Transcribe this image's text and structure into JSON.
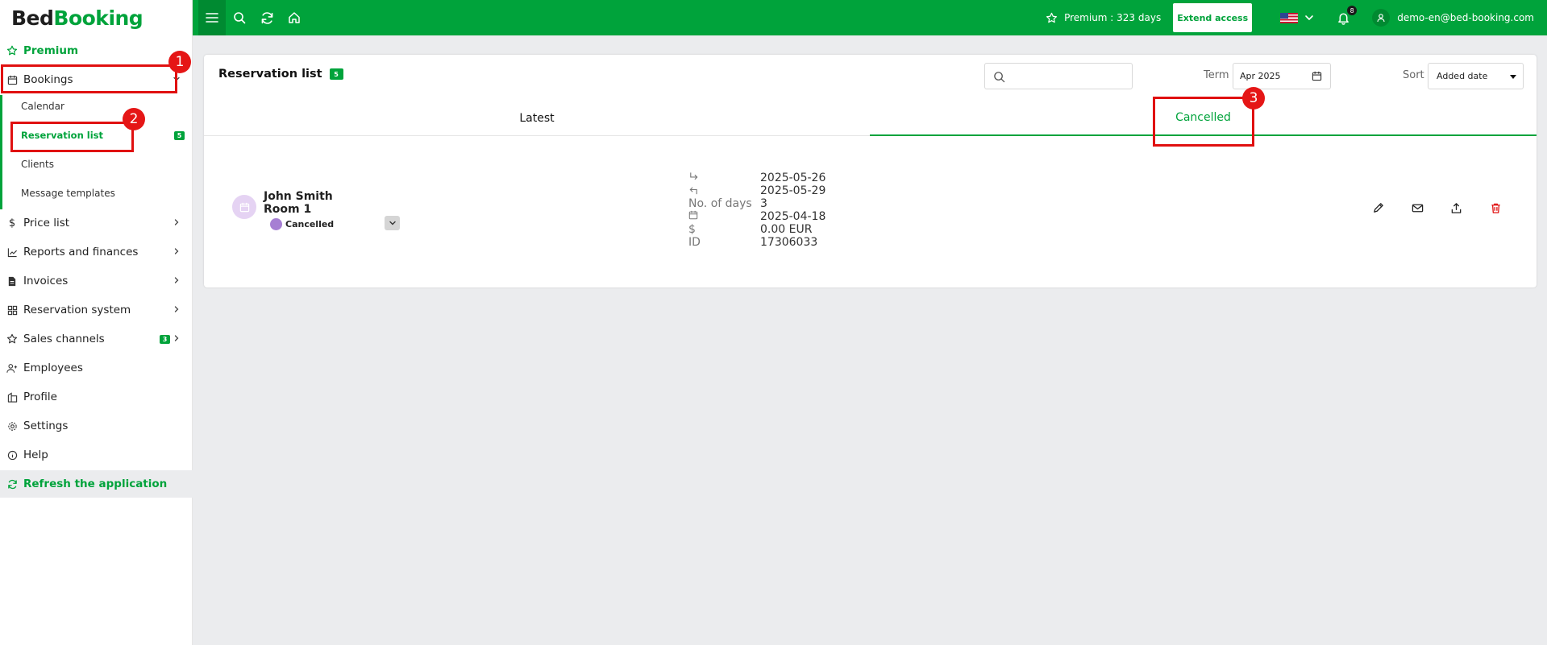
{
  "app": {
    "logo_part1": "Bed",
    "logo_part2": "Booking"
  },
  "topbar": {
    "premium_text": "Premium : 323 days",
    "extend_label": "Extend access",
    "notification_count": "8",
    "user_email": "demo-en@bed-booking.com"
  },
  "sidebar": {
    "premium": "Premium",
    "bookings": "Bookings",
    "calendar": "Calendar",
    "reservation_list": "Reservation list",
    "reservation_list_badge": "5",
    "clients": "Clients",
    "message_templates": "Message templates",
    "price_list": "Price list",
    "reports": "Reports and finances",
    "invoices": "Invoices",
    "reservation_system": "Reservation system",
    "sales_channels": "Sales channels",
    "sales_channels_badge": "3",
    "employees": "Employees",
    "profile": "Profile",
    "settings": "Settings",
    "help": "Help",
    "refresh": "Refresh the application"
  },
  "annotations": [
    "1",
    "2",
    "3"
  ],
  "main": {
    "title": "Reservation list",
    "title_badge": "5",
    "search_placeholder": "",
    "term_label": "Term",
    "term_value": "Apr 2025",
    "sort_label": "Sort",
    "sort_value": "Added date",
    "tabs": {
      "latest": "Latest",
      "cancelled": "Cancelled"
    }
  },
  "reservation": {
    "guest": "John Smith",
    "room": "Room 1",
    "status": "Cancelled",
    "details": [
      {
        "label": "",
        "value": "2025-05-26"
      },
      {
        "label": "",
        "value": "2025-05-29"
      },
      {
        "label": "No. of days",
        "value": "3"
      },
      {
        "label": "",
        "value": "2025-04-18"
      },
      {
        "label": "$",
        "value": "0.00 EUR"
      },
      {
        "label": "ID",
        "value": "17306033"
      }
    ]
  },
  "colors": {
    "brand": "#00a33b",
    "annotation": "#e01010",
    "status_cancelled": "#a67fd3"
  }
}
